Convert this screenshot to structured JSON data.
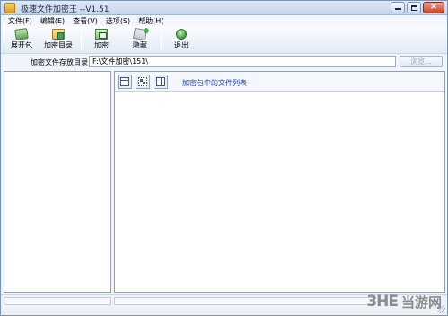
{
  "window": {
    "title": "极速文件加密王 --V1.51",
    "controls": {
      "minimize": "minimize",
      "maximize": "maximize",
      "close": "×"
    }
  },
  "menu": [
    "文件(F)",
    "编辑(E)",
    "查看(V)",
    "选项(S)",
    "帮助(H)"
  ],
  "toolbar": {
    "unpack": "展开包",
    "encrypt_dir": "加密目录",
    "encrypt": "加密",
    "hide": "隐藏",
    "exit": "退出"
  },
  "path_row": {
    "label": "加密文件存放目录:",
    "value": "F:\\文件加密\\151\\",
    "browse": "浏览..."
  },
  "right_pane": {
    "list_title": "加密包中的文件列表",
    "view_buttons": [
      "details-view-icon",
      "tree-view-icon",
      "columns-view-icon"
    ]
  },
  "status_bar": {
    "left": "",
    "right": ""
  },
  "watermark": {
    "logo": "3HE",
    "text": "当游网"
  },
  "colors": {
    "title_bar": "#c5d6ee",
    "frame": "#7a93b8",
    "accent_text": "#1b3fa8",
    "close_button": "#c54328"
  }
}
